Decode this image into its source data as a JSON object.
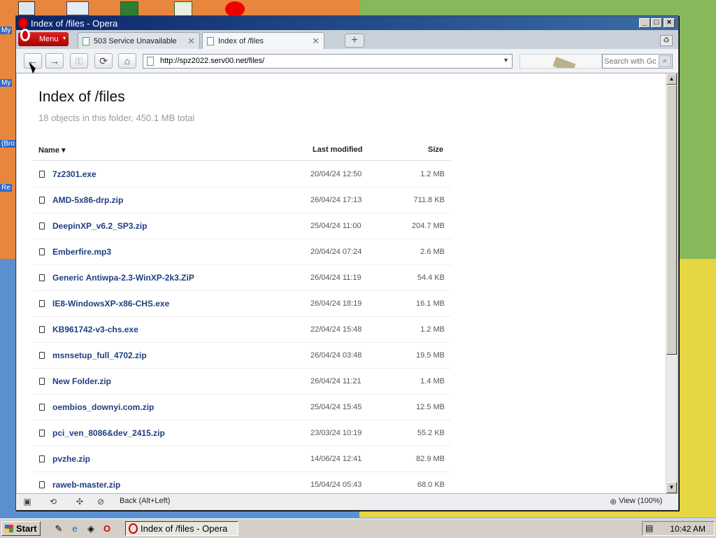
{
  "window": {
    "title": "Index of /files - Opera"
  },
  "tabs": {
    "menu_label": "Menu",
    "items": [
      {
        "label": "503 Service Unavailable"
      },
      {
        "label": "Index of /files"
      }
    ],
    "new_tab": "+"
  },
  "navbar": {
    "url": "http://spz2022.serv00.net/files/",
    "search_placeholder": "Search with Google"
  },
  "page": {
    "title": "Index of /files",
    "subtitle": "18 objects in this folder, 450.1 MB total",
    "columns": {
      "name": "Name ▾",
      "modified": "Last modified",
      "size": "Size"
    },
    "files": [
      {
        "name": "7z2301.exe",
        "modified": "20/04/24 12:50",
        "size": "1.2 MB"
      },
      {
        "name": "AMD-5x86-drp.zip",
        "modified": "26/04/24 17:13",
        "size": "711.8 KB"
      },
      {
        "name": "DeepinXP_v6.2_SP3.zip",
        "modified": "25/04/24 11:00",
        "size": "204.7 MB"
      },
      {
        "name": "Emberfire.mp3",
        "modified": "20/04/24 07:24",
        "size": "2.6 MB"
      },
      {
        "name": "Generic Antiwpa-2.3-WinXP-2k3.ZiP",
        "modified": "26/04/24 11:19",
        "size": "54.4 KB"
      },
      {
        "name": "IE8-WindowsXP-x86-CHS.exe",
        "modified": "26/04/24 18:19",
        "size": "16.1 MB"
      },
      {
        "name": "KB961742-v3-chs.exe",
        "modified": "22/04/24 15:48",
        "size": "1.2 MB"
      },
      {
        "name": "msnsetup_full_4702.zip",
        "modified": "26/04/24 03:48",
        "size": "19.5 MB"
      },
      {
        "name": "New Folder.zip",
        "modified": "26/04/24 11:21",
        "size": "1.4 MB"
      },
      {
        "name": "oembios_downyi.com.zip",
        "modified": "25/04/24 15:45",
        "size": "12.5 MB"
      },
      {
        "name": "pci_ven_8086&dev_2415.zip",
        "modified": "23/03/24 10:19",
        "size": "55.2 KB"
      },
      {
        "name": "pvzhe.zip",
        "modified": "14/06/24 12:41",
        "size": "82.9 MB"
      },
      {
        "name": "raweb-master.zip",
        "modified": "15/04/24 05:43",
        "size": "68.0 KB"
      }
    ]
  },
  "statusbar": {
    "hint": "Back (Alt+Left)",
    "zoom": "View (100%)"
  },
  "desktop": {
    "labels": [
      "My",
      "My",
      "(Bro",
      "Re"
    ]
  },
  "taskbar": {
    "start": "Start",
    "task": "Index of /files - Opera",
    "clock": "10:42 AM"
  }
}
